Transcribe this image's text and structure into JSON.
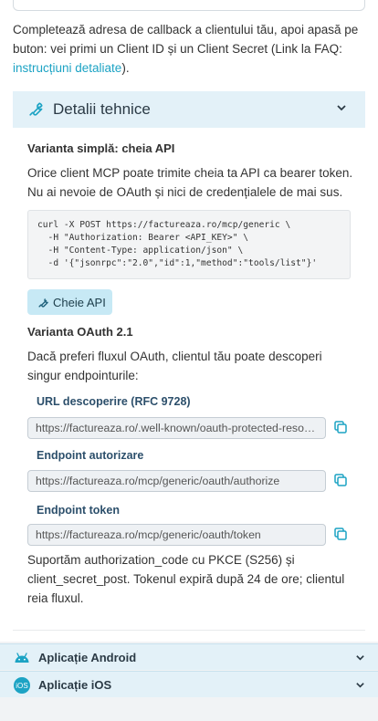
{
  "intro": {
    "text": "Completează adresa de callback a clientului tău, apoi apasă pe buton: vei primi un Client ID și un Client Secret (Link la FAQ: ",
    "link": "instrucțiuni detaliate",
    "suffix": ")."
  },
  "technical": {
    "title": "Detalii tehnice",
    "simple": {
      "heading": "Varianta simplă: cheia API",
      "text": "Orice client MCP poate trimite cheia ta API ca bearer token. Nu ai nevoie de OAuth și nici de credențialele de mai sus.",
      "code": "curl -X POST https://factureaza.ro/mcp/generic \\\n  -H \"Authorization: Bearer <API_KEY>\" \\\n  -H \"Content-Type: application/json\" \\\n  -d '{\"jsonrpc\":\"2.0\",\"id\":1,\"method\":\"tools/list\"}'",
      "button": "Cheie API"
    },
    "oauth": {
      "heading": "Varianta OAuth 2.1",
      "text": "Dacă preferi fluxul OAuth, clientul tău poate descoperi singur endpointurile:",
      "fields": [
        {
          "label": "URL descoperire (RFC 9728)",
          "value": "https://factureaza.ro/.well-known/oauth-protected-resource"
        },
        {
          "label": "Endpoint autorizare",
          "value": "https://factureaza.ro/mcp/generic/oauth/authorize"
        },
        {
          "label": "Endpoint token",
          "value": "https://factureaza.ro/mcp/generic/oauth/token"
        }
      ],
      "footer": "Suportăm authorization_code cu PKCE (S256) și client_secret_post. Tokenul expiră după 24 de ore; clientul reia fluxul."
    }
  },
  "apps": {
    "android": {
      "label": "Aplicație Android",
      "icon": "android-icon"
    },
    "ios": {
      "label": "Aplicație iOS",
      "icon": "ios-icon",
      "icon_text": "iOS"
    }
  },
  "colors": {
    "accent": "#1ca3c4",
    "section_bg": "#e3f1f8",
    "button_bg": "#c7e9f5",
    "label": "#2c4f6b"
  }
}
